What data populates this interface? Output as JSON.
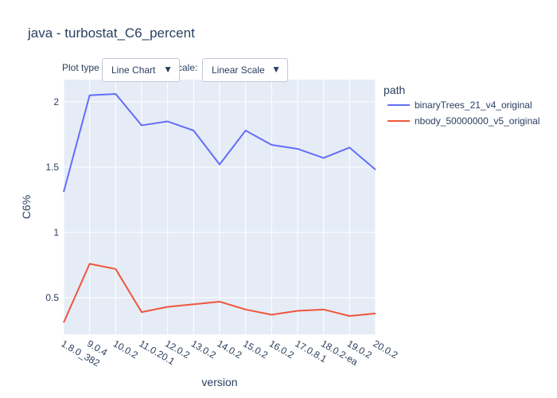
{
  "chart_data": {
    "type": "line",
    "title": "java - turbostat_C6_percent",
    "xlabel": "version",
    "ylabel": "C6%",
    "categories": [
      "1.8.0_382",
      "9.0.4",
      "10.0.2",
      "11.0.20.1",
      "12.0.2",
      "13.0.2",
      "14.0.2",
      "15.0.2",
      "16.0.2",
      "17.0.8.1",
      "18.0.2-ea",
      "19.0.2",
      "20.0.2"
    ],
    "ylim": [
      0.22,
      2.17
    ],
    "yticks": [
      0.5,
      1,
      1.5,
      2
    ],
    "ytick_labels": [
      "0.5",
      "1",
      "1.5",
      "2"
    ],
    "legend_title": "path",
    "legend_position": "top-right",
    "grid": true,
    "series": [
      {
        "name": "binaryTrees_21_v4_original",
        "color": "#636efa",
        "values": [
          1.31,
          2.05,
          2.06,
          1.82,
          1.85,
          1.78,
          1.52,
          1.78,
          1.67,
          1.64,
          1.57,
          1.65,
          1.48
        ]
      },
      {
        "name": "nbody_50000000_v5_original",
        "color": "#ef553b",
        "values": [
          0.31,
          0.76,
          0.72,
          0.39,
          0.43,
          0.45,
          0.47,
          0.41,
          0.37,
          0.4,
          0.41,
          0.36,
          0.38
        ]
      }
    ]
  },
  "controls": {
    "plot_type_label": "Plot type",
    "plot_type_value": "Line Chart",
    "scale_label": "Scale:",
    "scale_value": "Linear Scale",
    "arrow": "▼"
  }
}
